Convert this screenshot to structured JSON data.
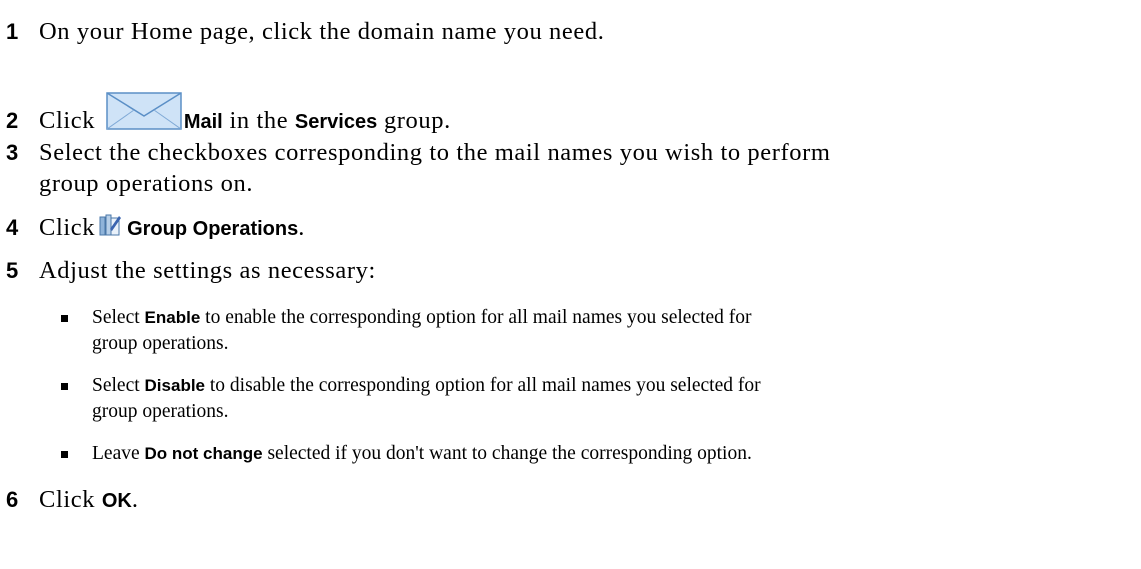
{
  "steps": [
    {
      "num": "1",
      "text": "On your Home page, click the domain name you need."
    },
    {
      "num": "2",
      "pre": "Click",
      "ui1": "Mail",
      "mid": "in the",
      "ui2": "Services",
      "post": "group."
    },
    {
      "num": "3",
      "line1": "Select the checkboxes corresponding to the mail names you wish to perform",
      "line2": "group operations on."
    },
    {
      "num": "4",
      "pre": "Click",
      "ui1": "Group Operations",
      "post": "."
    },
    {
      "num": "5",
      "text": "Adjust the settings as necessary:"
    },
    {
      "num": "6",
      "pre": "Click",
      "ui1": "OK",
      "post": "."
    }
  ],
  "bullets": [
    {
      "pre": "Select",
      "ui": "Enable",
      "line1": "to enable the corresponding option for all mail names you selected for",
      "line2": "group operations."
    },
    {
      "pre": "Select",
      "ui": "Disable",
      "line1": "to disable the corresponding option for all mail names you selected for",
      "line2": "group operations."
    },
    {
      "pre": "Leave",
      "ui": "Do not change",
      "line1": "selected if you don't want to change the corresponding option."
    }
  ],
  "icons": {
    "mail": "mail-envelope-icon",
    "group": "group-operations-icon"
  },
  "colors": {
    "text": "#000000",
    "envelope_fill": "#cfe3f7",
    "envelope_stroke": "#5b8fc6"
  }
}
